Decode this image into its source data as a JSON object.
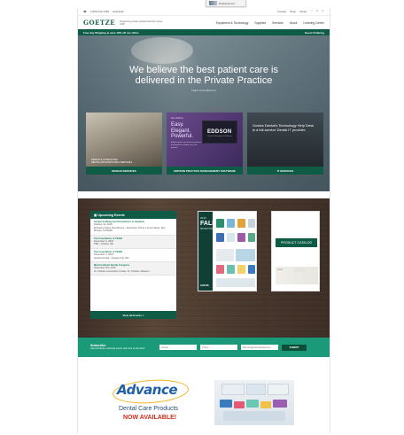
{
  "popup": {
    "label": "ReEquipment"
  },
  "utility": {
    "phone": "1-800-243-7260",
    "help": "Helpdesk",
    "contact": "Contact",
    "shop": "Shop",
    "about": "About",
    "social": [
      "f",
      "in",
      "yt"
    ]
  },
  "header": {
    "brand": "GOETZE",
    "brand_sub": "DENTAL",
    "tagline": "Supporting private practice dentistry since 1925",
    "nav": [
      "Equipment & Technology",
      "Supplies",
      "Services",
      "About",
      "Learning Center"
    ]
  },
  "promo": {
    "left": "Free day Shipping & save 10% off our offers",
    "right": "Guest Ordering"
  },
  "hero": {
    "headline_1": "We believe the best patient care is",
    "headline_2": "delivered in the Private Practice",
    "learn_more": "Learn more about us"
  },
  "cards": [
    {
      "caption": "DESIGN SERVICES",
      "text_1": "DESIGN & CONSULTING",
      "text_2": "DENTAL ARCHITECTURAL SERVICES"
    },
    {
      "caption": "EDDSON PRACTICE MANAGEMENT SOFTWARE",
      "small": "Meet Eddson",
      "big_1": "Easy.",
      "big_2": "Elegant.",
      "big_3": "Powerful.",
      "desc": "Eddson gives you the best practice management software for your practice",
      "brand": "EDDSON",
      "brand_sub": "Practice Management Software"
    },
    {
      "caption": "IT SERVICES",
      "text": "Goetze Dental's Technology Help Desk is a full-service Dental IT provider."
    }
  ],
  "events": {
    "title": "Upcoming Events",
    "items": [
      {
        "title": "Socket Grafting and Introduction to Implants",
        "date": "October 10, 2016",
        "place": "Embassy Suites Des Moines - Downtown 101 E. Locust Street, Des Moines, IA 50309"
      },
      {
        "title": "The Foundation of TEAM",
        "date": "November 3, 2016",
        "place": "TBD - Omaha, NE"
      },
      {
        "title": "The Foundation of TEAM",
        "date": "November 4, 2016",
        "place": "Goetze Dental - Kansas City, MO"
      },
      {
        "title": "Mid-Continent Dental Congress",
        "date": "November 8-9, 2016",
        "place": "St. Charles Convention Center, St. Charles, Missouri"
      }
    ],
    "view_all": "View all Events >"
  },
  "catalog_fall": {
    "year": "2016",
    "title_1": "FALL",
    "title_2": "PROMOTIONS",
    "brand": "GOETZE"
  },
  "catalog_product": {
    "title": "PRODUCT CATALOG",
    "since": "since",
    "year": "1925"
  },
  "subscribe": {
    "title": "Subscribe",
    "desc": "Get promotions, upcoming events, and more to your inbox",
    "first_placeholder": "Dental",
    "last_placeholder": "Thone",
    "email_placeholder": "dthome@goetzedental.com",
    "button": "SUBMIT"
  },
  "ad": {
    "brand": "Advance",
    "line1": "Dental Care Products",
    "line2": "NOW AVAILABLE!"
  },
  "colors": {
    "primary": "#0e5c45",
    "accent": "#1b9a79",
    "ad_blue": "#1e5fa8",
    "ad_red": "#d22a1e"
  }
}
